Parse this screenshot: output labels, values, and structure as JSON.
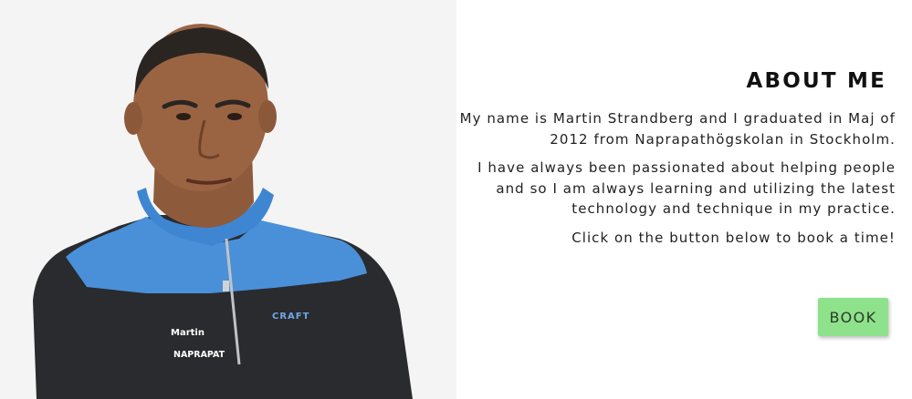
{
  "about": {
    "title": "ABOUT ME",
    "paragraph_1": "My name is Martin Strandberg and I graduated in Maj of 2012 from Naprapathögskolan in Stockholm.",
    "paragraph_2": "I have always been passionated about helping people and so I am always learning and utilizing the latest technology and technique in my practice.",
    "paragraph_3": "Click on the button below to book a time!",
    "book_label": "BOOK"
  },
  "photo": {
    "shirt_name": "Martin",
    "shirt_company": "NAPRAPAT",
    "shirt_brand": "CRAFT",
    "background_color": "#f4f4f5",
    "jacket_blue": "#4a90d9",
    "jacket_dark": "#2a2b2e"
  },
  "colors": {
    "button_green": "#8ee28b",
    "title_text": "#111111",
    "body_text": "#222222"
  }
}
